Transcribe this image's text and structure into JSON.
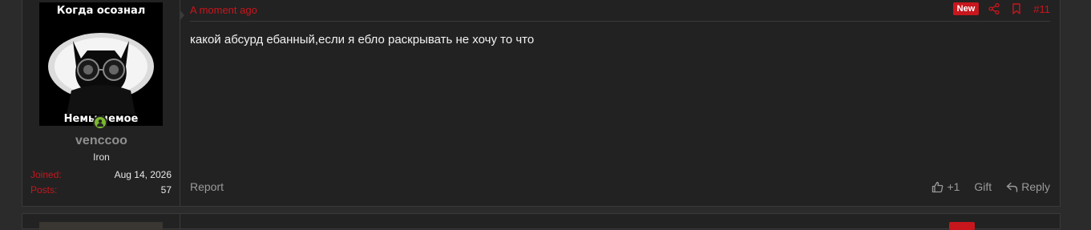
{
  "avatar": {
    "caption_top": "Когда осознал",
    "caption_bottom": "Немы чемое",
    "online_icon": "user-online-icon"
  },
  "user": {
    "name": "venccoo",
    "rank": "Iron",
    "joined_label": "Joined:",
    "joined_value": "Aug 14, 2026",
    "posts_label": "Posts:",
    "posts_value": "57"
  },
  "post": {
    "time": "A moment ago",
    "badge": "New",
    "number": "#11",
    "text": "какой абсурд ебанный,если я ебло раскрывать не хочу то что"
  },
  "footer": {
    "report": "Report",
    "like": "+1",
    "gift": "Gift",
    "reply": "Reply"
  },
  "colors": {
    "accent": "#c8161d",
    "online": "#7cb82f",
    "background": "#222222"
  }
}
